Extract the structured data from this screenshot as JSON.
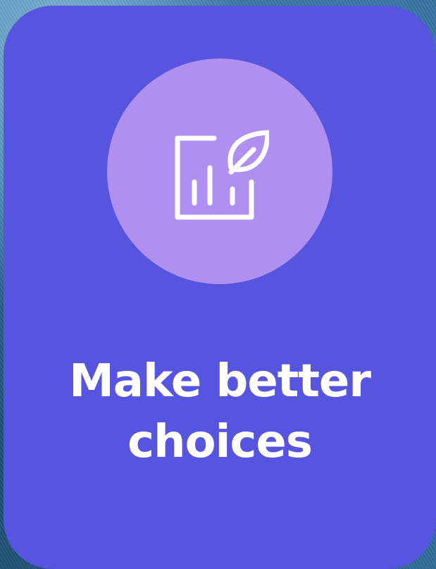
{
  "card": {
    "headline_line1": "Make better",
    "headline_line2": "choices",
    "icon": "chart-leaf-icon",
    "background_color": "#5754e0",
    "icon_circle_color": "#af8fef",
    "text_color": "#ffffff"
  }
}
